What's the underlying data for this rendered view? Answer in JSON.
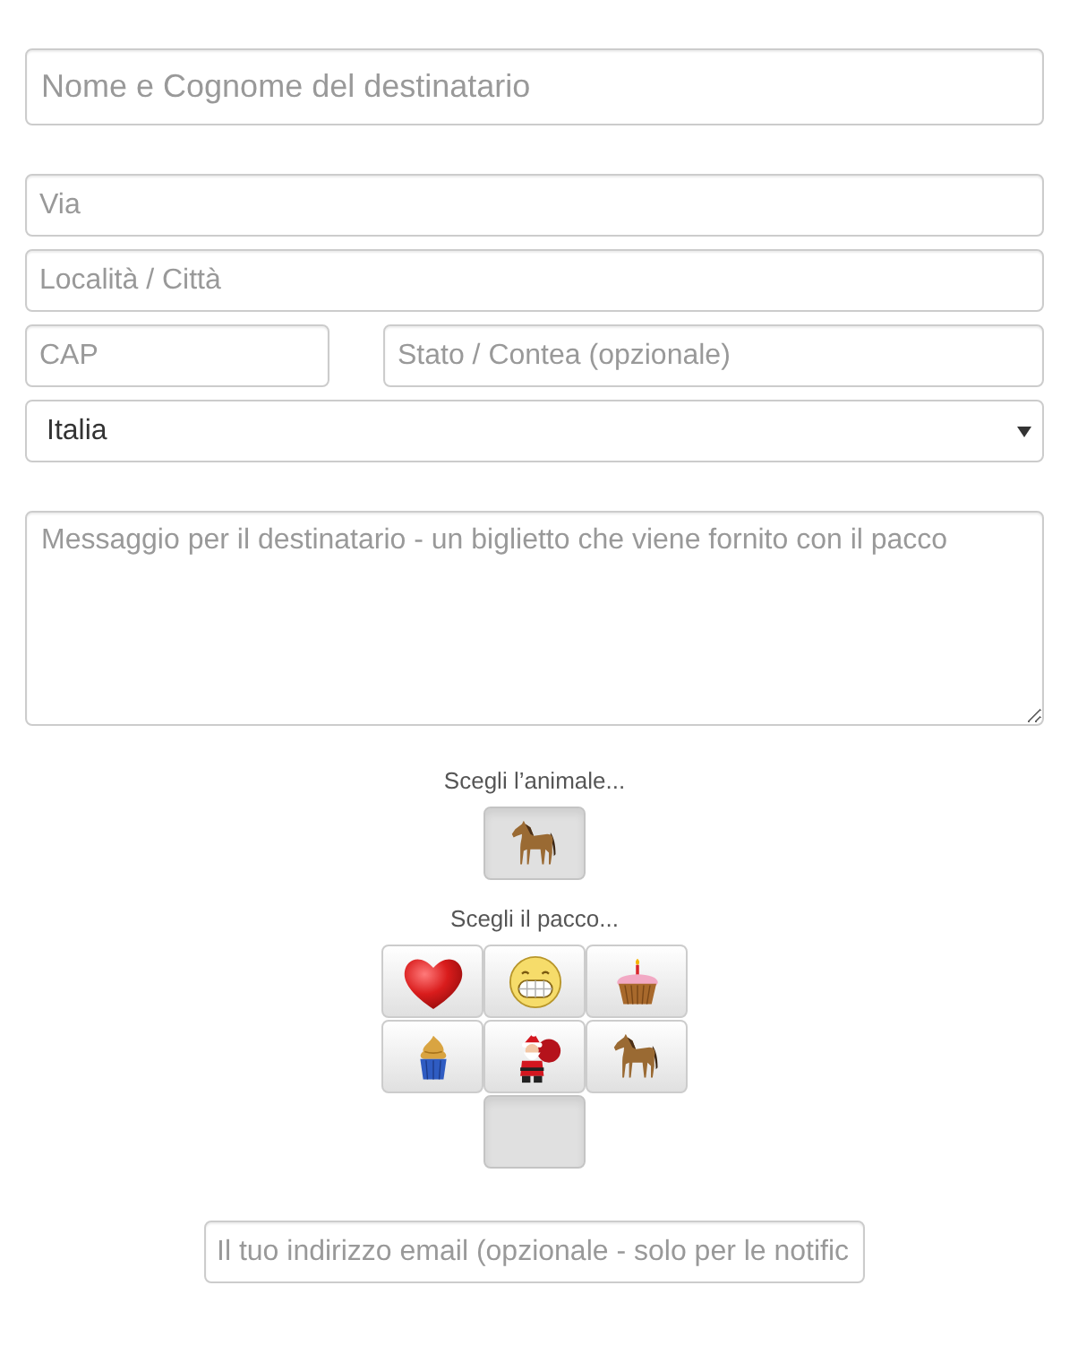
{
  "recipient": {
    "name": {
      "placeholder": "Nome e Cognome del destinatario"
    }
  },
  "address": {
    "street": {
      "placeholder": "Via"
    },
    "city": {
      "placeholder": "Località / Città"
    },
    "postcode": {
      "placeholder": "CAP"
    },
    "state": {
      "placeholder": "Stato / Contea (opzionale)"
    },
    "country": {
      "value": "Italia"
    }
  },
  "message": {
    "placeholder": "Messaggio per il destinatario - un biglietto che viene fornito con il pacco"
  },
  "animal_picker": {
    "label": "Scegli l’animale...",
    "options": [
      {
        "kind": "horse",
        "selected": true
      }
    ]
  },
  "package_picker": {
    "label": "Scegli il pacco...",
    "options": [
      {
        "kind": "heart",
        "selected": false
      },
      {
        "kind": "grin",
        "selected": false
      },
      {
        "kind": "cupcake",
        "selected": false
      },
      {
        "kind": "icecream",
        "selected": false
      },
      {
        "kind": "santa",
        "selected": false
      },
      {
        "kind": "horse",
        "selected": false
      },
      {
        "kind": "empty",
        "selected": true
      }
    ]
  },
  "email": {
    "placeholder": "Il tuo indirizzo email (opzionale - solo per le notific"
  }
}
